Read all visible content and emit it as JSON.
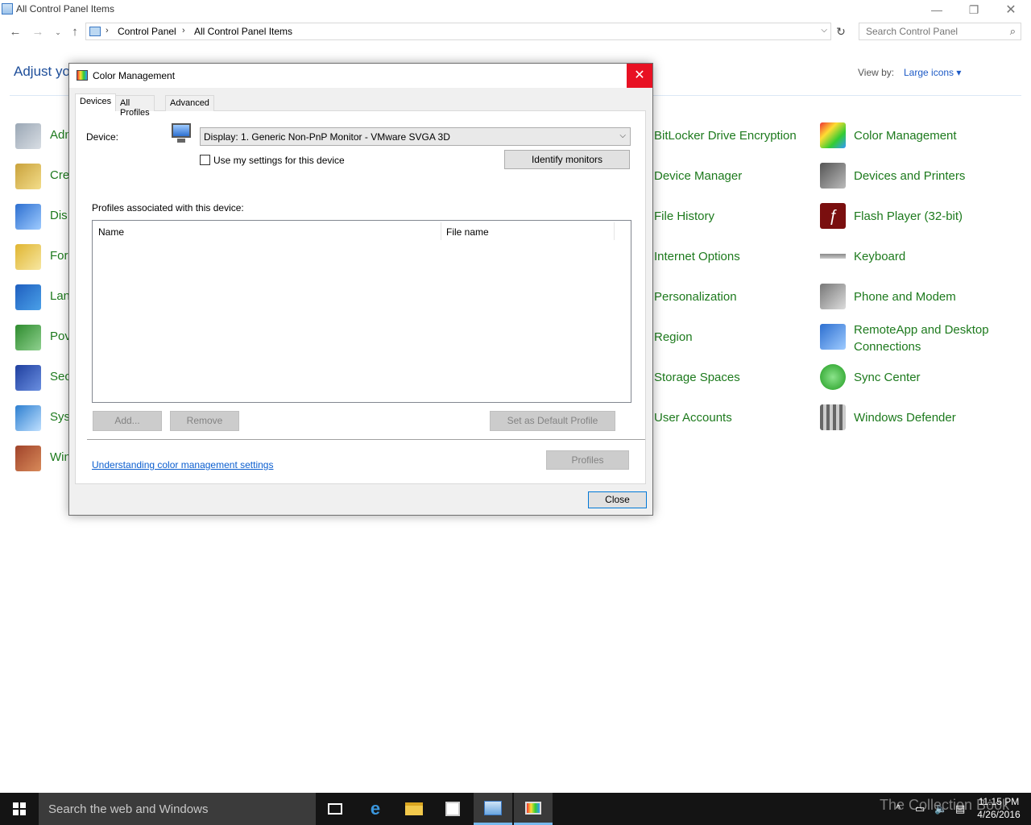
{
  "window": {
    "title": "All Control Panel Items",
    "controls": {
      "minimize": "—",
      "maximize": "❐",
      "close": "✕"
    }
  },
  "address": {
    "breadcrumbs": [
      "Control Panel",
      "All Control Panel Items"
    ],
    "search_placeholder": "Search Control Panel"
  },
  "control_panel": {
    "heading_partial": "Adjust yo",
    "view_by_label": "View by:",
    "view_by_value": "Large icons ▾",
    "left_items_partial": [
      "Adm",
      "Cre",
      "Dis",
      "For",
      "Lan",
      "Pov",
      "Sec",
      "Sys",
      "Win"
    ],
    "mid_items": [
      "BitLocker Drive Encryption",
      "Device Manager",
      "File History",
      "Internet Options",
      "Personalization",
      "Region",
      "Storage Spaces",
      "User Accounts"
    ],
    "right_items": [
      "Color Management",
      "Devices and Printers",
      "Flash Player (32-bit)",
      "Keyboard",
      "Phone and Modem",
      "RemoteApp and Desktop Connections",
      "Sync Center",
      "Windows Defender"
    ]
  },
  "dialog": {
    "title": "Color Management",
    "tabs": [
      "Devices",
      "All Profiles",
      "Advanced"
    ],
    "device_label": "Device:",
    "device_value": "Display: 1. Generic Non-PnP Monitor - VMware SVGA 3D",
    "use_settings_label": "Use my settings for this device",
    "use_settings_checked": false,
    "identify_button": "Identify monitors",
    "profiles_label": "Profiles associated with this device:",
    "columns": [
      "Name",
      "File name"
    ],
    "rows": [],
    "add_button": "Add...",
    "remove_button": "Remove",
    "set_default_button": "Set as Default Profile",
    "help_link": "Understanding color management settings",
    "profiles_button": "Profiles",
    "close_button": "Close"
  },
  "taskbar": {
    "search_text": "Search the web and Windows",
    "time": "11:15 PM",
    "date": "4/26/2016",
    "watermark": "The Collection Book"
  }
}
